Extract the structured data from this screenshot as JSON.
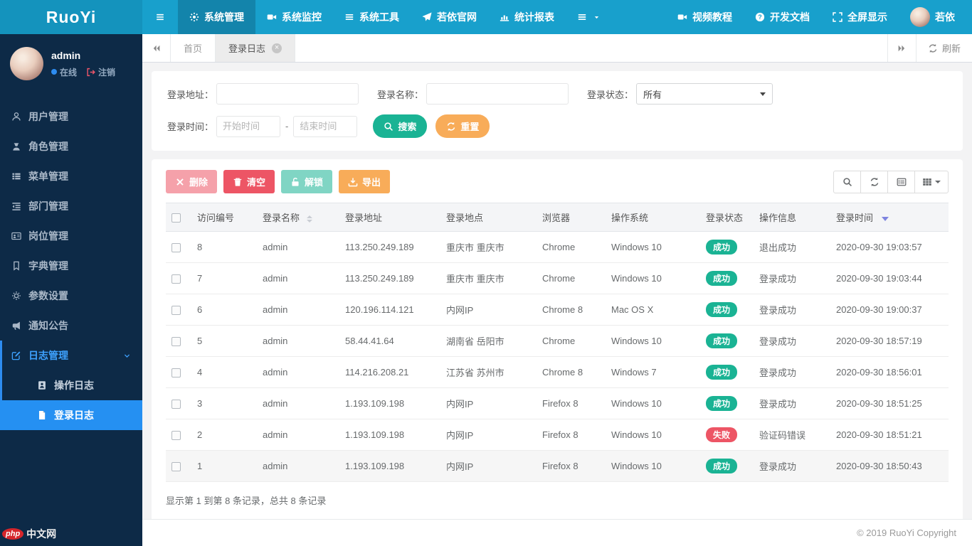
{
  "brand": "RuoYi",
  "colors": {
    "navbar": "#18a0cc",
    "sidebar": "#0d2a47",
    "accent": "#2590f2",
    "success": "#1ab394",
    "danger": "#ed5565",
    "warning": "#f8ac59"
  },
  "navbar": {
    "menu": [
      {
        "name": "system-manage",
        "label": "系统管理",
        "icon": "gear-icon",
        "active": true
      },
      {
        "name": "system-monitor",
        "label": "系统监控",
        "icon": "video-icon"
      },
      {
        "name": "system-tools",
        "label": "系统工具",
        "icon": "list-icon"
      },
      {
        "name": "ruoyi-site",
        "label": "若依官网",
        "icon": "send-icon"
      },
      {
        "name": "stats-report",
        "label": "统计报表",
        "icon": "chart-icon"
      },
      {
        "name": "more-menus",
        "label": "",
        "icon": "list-icon",
        "caret": true
      }
    ],
    "right": [
      {
        "name": "video-tutorial",
        "label": "视频教程",
        "icon": "video-icon"
      },
      {
        "name": "dev-docs",
        "label": "开发文档",
        "icon": "question-icon"
      },
      {
        "name": "fullscreen",
        "label": "全屏显示",
        "icon": "fullscreen-icon"
      }
    ],
    "user": {
      "name": "若依"
    }
  },
  "sidebar": {
    "user": {
      "name": "admin",
      "status": "在线",
      "logout": "注销"
    },
    "items": [
      {
        "name": "users",
        "label": "用户管理",
        "icon": "user-icon"
      },
      {
        "name": "roles",
        "label": "角色管理",
        "icon": "role-icon"
      },
      {
        "name": "menus",
        "label": "菜单管理",
        "icon": "menu-icon"
      },
      {
        "name": "depts",
        "label": "部门管理",
        "icon": "dept-icon"
      },
      {
        "name": "posts",
        "label": "岗位管理",
        "icon": "post-icon"
      },
      {
        "name": "dicts",
        "label": "字典管理",
        "icon": "dict-icon"
      },
      {
        "name": "params",
        "label": "参数设置",
        "icon": "param-icon"
      },
      {
        "name": "notices",
        "label": "通知公告",
        "icon": "notice-icon"
      },
      {
        "name": "logs",
        "label": "日志管理",
        "icon": "log-icon",
        "expanded": true,
        "children": [
          {
            "name": "operlog",
            "label": "操作日志",
            "icon": "oplog-icon"
          },
          {
            "name": "loginlog",
            "label": "登录日志",
            "icon": "loginlog-icon",
            "active": true
          }
        ]
      }
    ]
  },
  "tabbar": {
    "tabs": [
      {
        "label": "首页"
      },
      {
        "label": "登录日志",
        "active": true,
        "closable": true
      }
    ],
    "refresh_label": "刷新"
  },
  "search": {
    "address_label": "登录地址：",
    "name_label": "登录名称：",
    "status_label": "登录状态：",
    "status_value": "所有",
    "time_label": "登录时间：",
    "start_placeholder": "开始时间",
    "end_placeholder": "结束时间",
    "separator": "-",
    "search_label": "搜索",
    "reset_label": "重置"
  },
  "toolbar": {
    "buttons": [
      {
        "name": "delete",
        "label": "删除",
        "icon": "x-icon",
        "style": "danger",
        "disabled": true
      },
      {
        "name": "clean",
        "label": "清空",
        "icon": "trash-icon",
        "style": "danger"
      },
      {
        "name": "unlock",
        "label": "解锁",
        "icon": "unlock-icon",
        "style": "success",
        "disabled": true
      },
      {
        "name": "export",
        "label": "导出",
        "icon": "download-icon",
        "style": "warning"
      }
    ]
  },
  "table": {
    "columns": [
      "",
      "访问编号",
      "登录名称",
      "登录地址",
      "登录地点",
      "浏览器",
      "操作系统",
      "登录状态",
      "操作信息",
      "登录时间"
    ],
    "rows": [
      {
        "id": "8",
        "name": "admin",
        "address": "113.250.249.189",
        "location": "重庆市 重庆市",
        "browser": "Chrome",
        "os": "Windows 10",
        "status": "成功",
        "status_type": "success",
        "message": "退出成功",
        "time": "2020-09-30 19:03:57"
      },
      {
        "id": "7",
        "name": "admin",
        "address": "113.250.249.189",
        "location": "重庆市 重庆市",
        "browser": "Chrome",
        "os": "Windows 10",
        "status": "成功",
        "status_type": "success",
        "message": "登录成功",
        "time": "2020-09-30 19:03:44"
      },
      {
        "id": "6",
        "name": "admin",
        "address": "120.196.114.121",
        "location": "内网IP",
        "browser": "Chrome 8",
        "os": "Mac OS X",
        "status": "成功",
        "status_type": "success",
        "message": "登录成功",
        "time": "2020-09-30 19:00:37"
      },
      {
        "id": "5",
        "name": "admin",
        "address": "58.44.41.64",
        "location": "湖南省 岳阳市",
        "browser": "Chrome",
        "os": "Windows 10",
        "status": "成功",
        "status_type": "success",
        "message": "登录成功",
        "time": "2020-09-30 18:57:19"
      },
      {
        "id": "4",
        "name": "admin",
        "address": "114.216.208.21",
        "location": "江苏省 苏州市",
        "browser": "Chrome 8",
        "os": "Windows 7",
        "status": "成功",
        "status_type": "success",
        "message": "登录成功",
        "time": "2020-09-30 18:56:01"
      },
      {
        "id": "3",
        "name": "admin",
        "address": "1.193.109.198",
        "location": "内网IP",
        "browser": "Firefox 8",
        "os": "Windows 10",
        "status": "成功",
        "status_type": "success",
        "message": "登录成功",
        "time": "2020-09-30 18:51:25"
      },
      {
        "id": "2",
        "name": "admin",
        "address": "1.193.109.198",
        "location": "内网IP",
        "browser": "Firefox 8",
        "os": "Windows 10",
        "status": "失败",
        "status_type": "danger",
        "message": "验证码错误",
        "time": "2020-09-30 18:51:21"
      },
      {
        "id": "1",
        "name": "admin",
        "address": "1.193.109.198",
        "location": "内网IP",
        "browser": "Firefox 8",
        "os": "Windows 10",
        "status": "成功",
        "status_type": "success",
        "message": "登录成功",
        "time": "2020-09-30 18:50:43",
        "shaded": true
      }
    ],
    "summary": "显示第 1 到第 8 条记录，总共 8 条记录"
  },
  "footer": {
    "copyright": "© 2019 RuoYi Copyright"
  },
  "watermark": {
    "badge": "php",
    "text": "中文网"
  }
}
